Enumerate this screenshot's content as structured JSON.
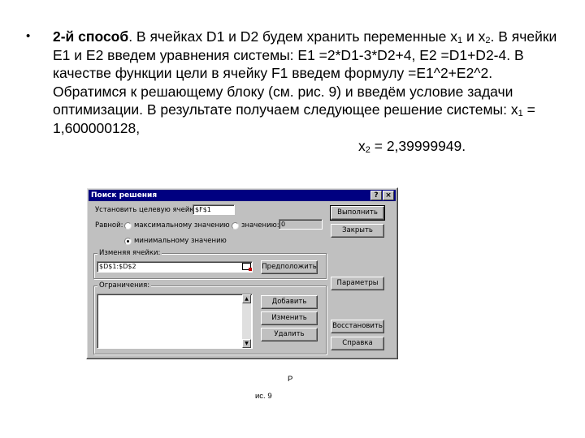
{
  "text": {
    "bullet": "•",
    "method_label": "2-й способ",
    "p1_a": ". В ячейках D1 и D2 будем хранить переменные x",
    "sub1": "1",
    "p1_b": " и x",
    "sub2": "2",
    "p1_c": ". В ячейки E1 и E2 введем уравнения системы: E1 =2*D1-3*D2+4, E2 =D1+D2-4. В качестве функции цели в ячейку F1 введем формулу =E1^2+E2^2. Обратимся к решающему блоку (см. рис. 9) и введём условие задачи оптимизации. В результате получаем следующее решение системы: x",
    "sub3": "1",
    "p1_d": " = 1,600000128,",
    "x2_a": "x",
    "sub4": "2",
    "x2_b": " = 2,39999949."
  },
  "dialog": {
    "title": "Поиск решения",
    "help_btn": "?",
    "close_btn": "×",
    "target_label": "Установить целевую ячейку:",
    "target_value": "$F$1",
    "equal_label": "Равной:",
    "opt_max": "максимальному значению",
    "opt_value": "значению:",
    "value_field": "0",
    "opt_min": "минимальному значению",
    "changing_label": "Изменяя ячейки:",
    "changing_value": "$D$1:$D$2",
    "guess_btn": "Предположить",
    "constraints_label": "Ограничения:",
    "add_btn": "Добавить",
    "change_btn": "Изменить",
    "delete_btn": "Удалить",
    "solve_btn": "Выполнить",
    "close_action_btn": "Закрыть",
    "options_btn": "Параметры",
    "reset_btn": "Восстановить",
    "help_action_btn": "Справка"
  },
  "caption": {
    "line1": "Р",
    "line2": "ис. 9"
  }
}
